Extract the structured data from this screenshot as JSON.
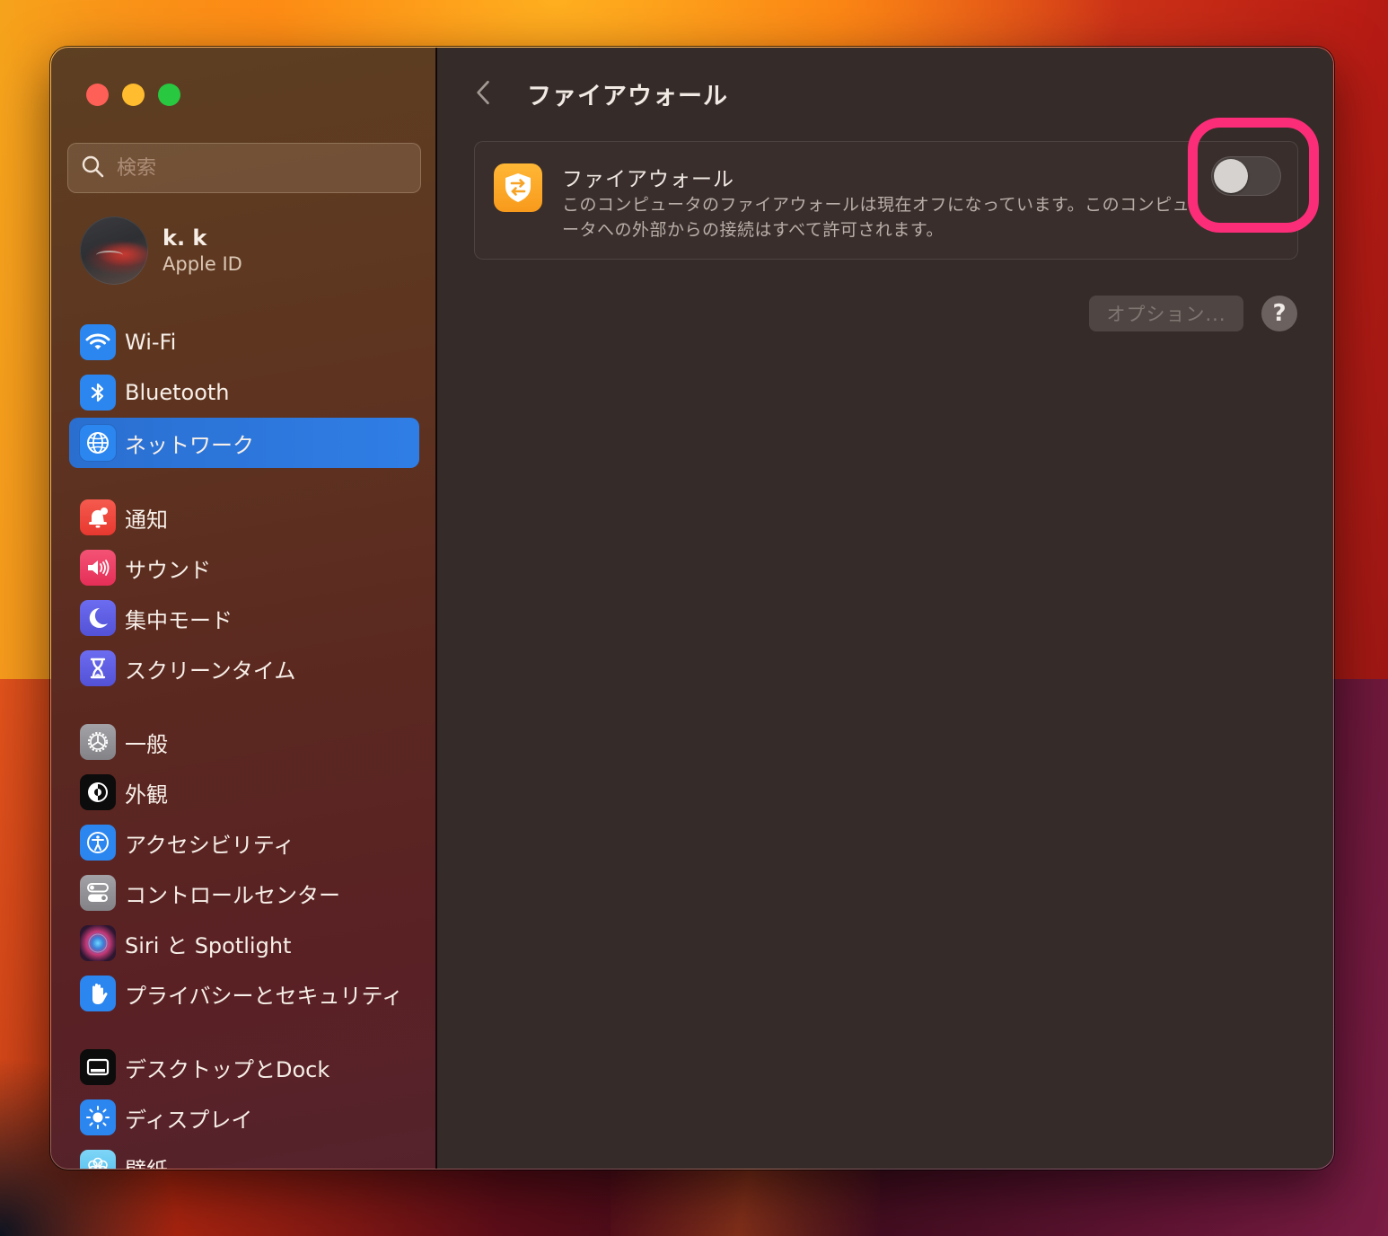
{
  "window": {
    "traffic_lights": [
      "close",
      "minimize",
      "zoom"
    ]
  },
  "sidebar": {
    "search": {
      "placeholder": "検索",
      "value": ""
    },
    "account": {
      "name": "k. k",
      "subtitle": "Apple ID"
    },
    "items": [
      {
        "label": "Wi-Fi",
        "icon": "wifi-icon",
        "color": "#2b86f0",
        "active": false
      },
      {
        "label": "Bluetooth",
        "icon": "bluetooth-icon",
        "color": "#2b86f0",
        "active": false
      },
      {
        "label": "ネットワーク",
        "icon": "globe-icon",
        "color": "#2b86f0",
        "active": true
      },
      {
        "label": "通知",
        "icon": "bell-icon",
        "color": "#f0453c",
        "active": false
      },
      {
        "label": "サウンド",
        "icon": "speaker-icon",
        "color": "#ee3c62",
        "active": false
      },
      {
        "label": "集中モード",
        "icon": "moon-icon",
        "color": "#5d5ce0",
        "active": false
      },
      {
        "label": "スクリーンタイム",
        "icon": "hourglass-icon",
        "color": "#5d5ce0",
        "active": false
      },
      {
        "label": "一般",
        "icon": "gear-icon",
        "color": "#8e8e93",
        "active": false
      },
      {
        "label": "外観",
        "icon": "appearance-icon",
        "color": "#111111",
        "active": false
      },
      {
        "label": "アクセシビリティ",
        "icon": "accessibility-icon",
        "color": "#2b86f0",
        "active": false
      },
      {
        "label": "コントロールセンター",
        "icon": "control-center-icon",
        "color": "#8e8e93",
        "active": false
      },
      {
        "label": "Siri と Spotlight",
        "icon": "siri-icon",
        "color": "#2a1a2e",
        "active": false
      },
      {
        "label": "プライバシーとセキュリティ",
        "icon": "hand-icon",
        "color": "#2b86f0",
        "active": false
      },
      {
        "label": "デスクトップとDock",
        "icon": "dock-icon",
        "color": "#111111",
        "active": false
      },
      {
        "label": "ディスプレイ",
        "icon": "sun-icon",
        "color": "#2b86f0",
        "active": false
      },
      {
        "label": "壁紙",
        "icon": "wallpaper-icon",
        "color": "#5ac8f0",
        "active": false
      }
    ]
  },
  "main": {
    "back_icon": "chevron-left-icon",
    "title": "ファイアウォール",
    "firewall": {
      "icon": "firewall-shield-icon",
      "icon_color": "#f9a11f",
      "title": "ファイアウォール",
      "description": "このコンピュータのファイアウォールは現在オフになっています。このコンピュータへの外部からの接続はすべて許可されます。",
      "enabled": false
    },
    "highlight_color": "#fb2d78",
    "options_button": "オプション...",
    "help_button": "?"
  }
}
